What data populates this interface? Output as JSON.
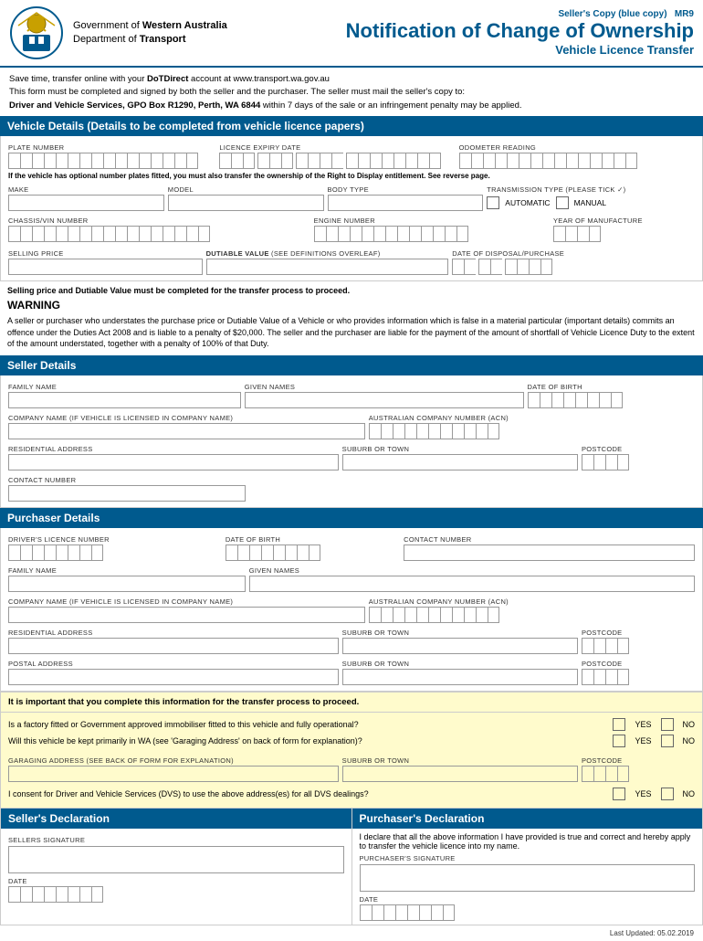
{
  "header": {
    "gov_line1": "Government of ",
    "gov_bold1": "Western Australia",
    "gov_line2": "Department of ",
    "gov_bold2": "Transport",
    "seller_copy": "Seller's Copy (blue copy)",
    "mr9": "MR9",
    "title_main": "Notification of Change of Ownership",
    "title_sub": "Vehicle Licence Transfer"
  },
  "intro": {
    "line1": "Save time, transfer online with your DoTDirect account at www.transport.wa.gov.au",
    "line2": "This form must be completed and signed by both the seller and the purchaser. The seller must mail the seller's copy to:",
    "line3_bold": "Driver and Vehicle Services, GPO Box R1290, Perth, WA 6844",
    "line3_rest": " within 7 days of the sale or an infringement penalty may be applied."
  },
  "vehicle_section": {
    "header": "Vehicle Details (Details to be completed from vehicle licence papers)",
    "plate_number": "PLATE NUMBER",
    "licence_expiry": "LICENCE EXPIRY DATE",
    "odometer": "ODOMETER READING",
    "optional_note": "If the vehicle has optional number plates fitted, you must also transfer the ownership of the Right to Display entitlement. See reverse page.",
    "make": "MAKE",
    "model": "MODEL",
    "body_type": "BODY TYPE",
    "transmission": "TRANSMISSION TYPE (PLEASE TICK ✓)",
    "automatic": "AUTOMATIC",
    "manual": "MANUAL",
    "chassis": "CHASSIS/VIN NUMBER",
    "engine": "ENGINE NUMBER",
    "year": "YEAR OF MANUFACTURE",
    "selling_price": "SELLING PRICE",
    "dutiable_value": "DUTIABLE VALUE",
    "dutiable_note": "(SEE DEFINITIONS OVERLEAF)",
    "disposal_date": "DATE OF DISPOSAL/PURCHASE",
    "warning_note": "Selling price and Dutiable Value must be completed for the transfer process to proceed.",
    "warning_title": "WARNING",
    "warning_text": "A seller or purchaser who understates the purchase price or Dutiable Value of a Vehicle or who provides information which is false in a material particular (important details) commits an offence under the Duties Act 2008 and is liable to a penalty of $20,000. The seller and the purchaser are liable for the payment of the amount of shortfall of Vehicle Licence Duty to the extent of the amount understated, together with a penalty of 100% of that Duty."
  },
  "seller_section": {
    "header": "Seller Details",
    "family_name_label": "FAMILY NAME",
    "given_names_label": "GIVEN NAMES",
    "dob_label": "DATE OF BIRTH",
    "company_label": "COMPANY NAME (IF VEHICLE IS LICENSED IN COMPANY NAME)",
    "acn_label": "AUSTRALIAN COMPANY NUMBER (ACN)",
    "residential_label": "RESIDENTIAL ADDRESS",
    "suburb_label": "SUBURB OR TOWN",
    "postcode_label": "POSTCODE",
    "contact_label": "CONTACT NUMBER"
  },
  "purchaser_section": {
    "header": "Purchaser Details",
    "licence_label": "DRIVER'S LICENCE NUMBER",
    "dob_label": "DATE OF BIRTH",
    "contact_label": "CONTACT NUMBER",
    "family_label": "FAMILY NAME",
    "given_label": "GIVEN NAMES",
    "company_label": "COMPANY NAME (IF VEHICLE IS LICENSED IN COMPANY NAME)",
    "acn_label": "AUSTRALIAN COMPANY NUMBER (ACN)",
    "residential_label": "RESIDENTIAL ADDRESS",
    "suburb_label": "SUBURB OR TOWN",
    "postcode_label": "POSTCODE",
    "postal_label": "POSTAL ADDRESS",
    "postal_suburb_label": "SUBURB OR TOWN",
    "postal_postcode_label": "POSTCODE"
  },
  "important_section": {
    "header": "It is important that you complete this information for the transfer process to proceed.",
    "q1": "Is a factory fitted or Government approved immobiliser fitted to this vehicle and fully operational?",
    "q2": "Will this vehicle be kept primarily in WA (see 'Garaging Address' on back of form for explanation)?",
    "yes": "YES",
    "no": "NO",
    "garaging_label": "GARAGING ADDRESS (SEE BACK OF FORM FOR EXPLANATION)",
    "suburb_label": "SUBURB OR TOWN",
    "postcode_label": "POSTCODE",
    "consent_text": "I consent for Driver and Vehicle Services (DVS) to use the above address(es) for all DVS dealings?"
  },
  "seller_declaration": {
    "header": "Seller's Declaration",
    "signature_label": "SELLERS SIGNATURE",
    "date_label": "DATE"
  },
  "purchaser_declaration": {
    "header": "Purchaser's Declaration",
    "text": "I declare that all the above information I have provided is true and correct and hereby apply to transfer the vehicle licence into my name.",
    "signature_label": "PURCHASER'S SIGNATURE",
    "date_label": "DATE"
  },
  "footer": {
    "last_updated": "Last Updated: 05.02.2019"
  }
}
